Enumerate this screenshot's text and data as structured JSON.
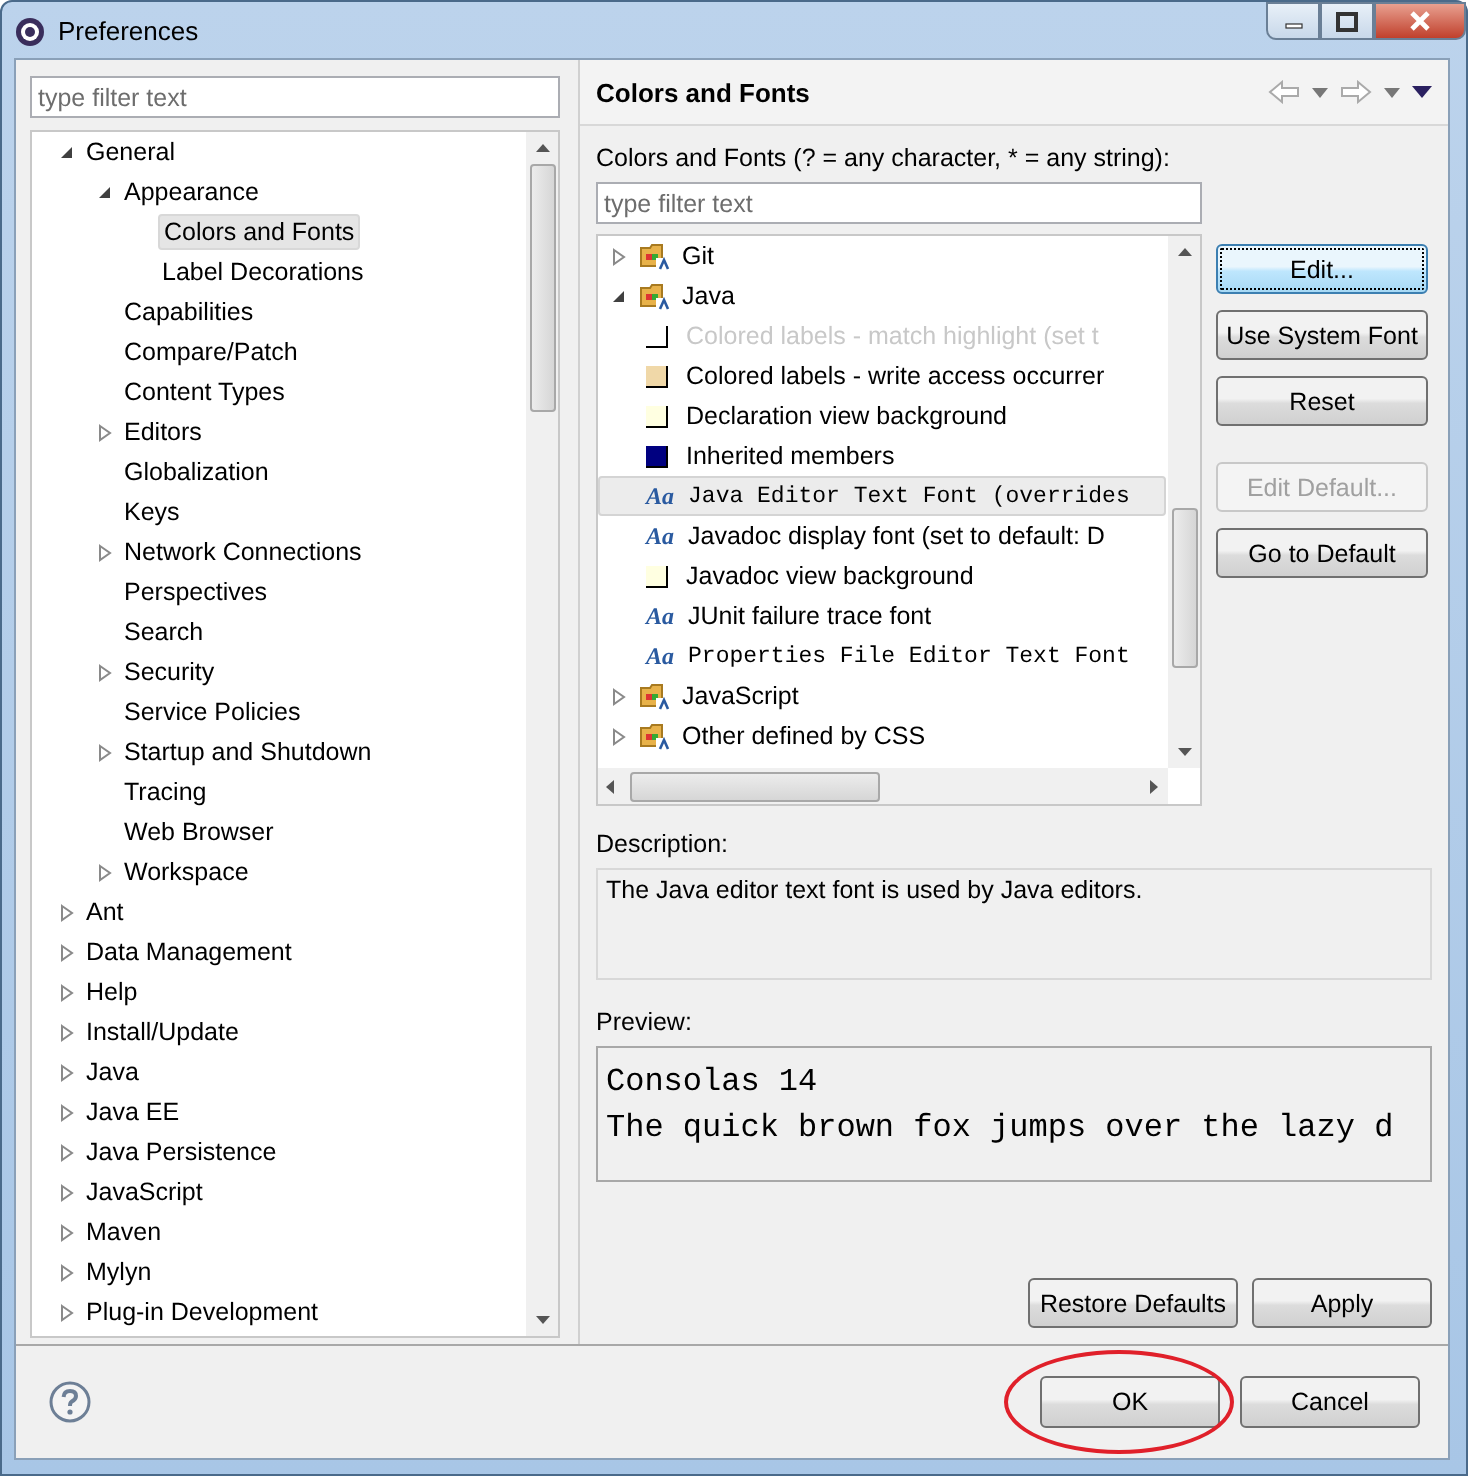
{
  "window": {
    "title": "Preferences"
  },
  "filter": {
    "placeholder": "type filter text"
  },
  "nav_tree": [
    {
      "label": "General",
      "expanded": true,
      "selected": false,
      "children": [
        {
          "label": "Appearance",
          "expanded": true,
          "selected": false,
          "children": [
            {
              "label": "Colors and Fonts",
              "selected": true
            },
            {
              "label": "Label Decorations",
              "selected": false
            }
          ]
        },
        {
          "label": "Capabilities",
          "selected": false
        },
        {
          "label": "Compare/Patch",
          "selected": false
        },
        {
          "label": "Content Types",
          "selected": false
        },
        {
          "label": "Editors",
          "expanded": false,
          "selected": false
        },
        {
          "label": "Globalization",
          "selected": false
        },
        {
          "label": "Keys",
          "selected": false
        },
        {
          "label": "Network Connections",
          "expanded": false,
          "selected": false
        },
        {
          "label": "Perspectives",
          "selected": false
        },
        {
          "label": "Search",
          "selected": false
        },
        {
          "label": "Security",
          "expanded": false,
          "selected": false
        },
        {
          "label": "Service Policies",
          "selected": false
        },
        {
          "label": "Startup and Shutdown",
          "expanded": false,
          "selected": false
        },
        {
          "label": "Tracing",
          "selected": false
        },
        {
          "label": "Web Browser",
          "selected": false
        },
        {
          "label": "Workspace",
          "expanded": false,
          "selected": false
        }
      ]
    },
    {
      "label": "Ant",
      "expanded": false,
      "selected": false
    },
    {
      "label": "Data Management",
      "expanded": false,
      "selected": false
    },
    {
      "label": "Help",
      "expanded": false,
      "selected": false
    },
    {
      "label": "Install/Update",
      "expanded": false,
      "selected": false
    },
    {
      "label": "Java",
      "expanded": false,
      "selected": false
    },
    {
      "label": "Java EE",
      "expanded": false,
      "selected": false
    },
    {
      "label": "Java Persistence",
      "expanded": false,
      "selected": false
    },
    {
      "label": "JavaScript",
      "expanded": false,
      "selected": false
    },
    {
      "label": "Maven",
      "expanded": false,
      "selected": false
    },
    {
      "label": "Mylyn",
      "expanded": false,
      "selected": false
    },
    {
      "label": "Plug-in Development",
      "expanded": false,
      "selected": false
    }
  ],
  "page": {
    "title": "Colors and Fonts",
    "filter_label": "Colors and Fonts (? = any character, * = any string):",
    "filter": {
      "placeholder": "type filter text"
    },
    "items": [
      {
        "kind": "category",
        "label": "Git",
        "expanded": false,
        "selected": false
      },
      {
        "kind": "category",
        "label": "Java",
        "expanded": true,
        "selected": false,
        "children": [
          {
            "kind": "color",
            "label": "Colored labels - match highlight (set t",
            "color": "#ffffff",
            "dimmed": true,
            "selected": false
          },
          {
            "kind": "color",
            "label": "Colored labels - write access occurrer",
            "color": "#f0d8a8",
            "dimmed": false,
            "selected": false
          },
          {
            "kind": "color",
            "label": "Declaration view background",
            "color": "#ffffe1",
            "dimmed": false,
            "selected": false
          },
          {
            "kind": "color",
            "label": "Inherited members",
            "color": "#000080",
            "dimmed": false,
            "selected": false
          },
          {
            "kind": "font",
            "icon": "Aa",
            "label": "Java Editor Text Font (overrides",
            "monospace": true,
            "selected": true
          },
          {
            "kind": "font",
            "icon": "Aa",
            "label": "Javadoc display font (set to default: D",
            "monospace": false,
            "selected": false
          },
          {
            "kind": "color",
            "label": "Javadoc view background",
            "color": "#ffffe1",
            "dimmed": false,
            "selected": false
          },
          {
            "kind": "font",
            "icon": "Aa",
            "label": "JUnit failure trace font",
            "monospace": false,
            "selected": false
          },
          {
            "kind": "font",
            "icon": "Aa",
            "label": "Properties File Editor Text Font",
            "monospace": true,
            "selected": false
          }
        ]
      },
      {
        "kind": "category",
        "label": "JavaScript",
        "expanded": false,
        "selected": false
      },
      {
        "kind": "category",
        "label": "Other defined by CSS",
        "expanded": false,
        "selected": false
      }
    ],
    "side_buttons": [
      {
        "label": "Edit...",
        "disabled": false,
        "focused": true
      },
      {
        "label": "Use System Font",
        "disabled": false,
        "focused": false
      },
      {
        "label": "Reset",
        "disabled": false,
        "focused": false
      },
      {
        "label": "Edit Default...",
        "disabled": true,
        "focused": false
      },
      {
        "label": "Go to Default",
        "disabled": false,
        "focused": false
      }
    ],
    "description_label": "Description:",
    "description": "The Java editor text font is used by Java editors.",
    "preview_label": "Preview:",
    "preview_lines": [
      "Consolas 14",
      "The quick brown fox jumps over the lazy d"
    ],
    "page_buttons": [
      "Restore Defaults",
      "Apply"
    ]
  },
  "dialog_buttons": [
    {
      "label": "OK",
      "circled": true
    },
    {
      "label": "Cancel",
      "circled": false
    }
  ]
}
